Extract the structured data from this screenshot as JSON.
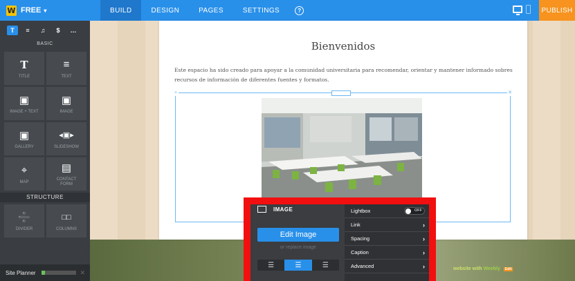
{
  "topbar": {
    "plan_label": "FREE",
    "tabs": [
      {
        "label": "BUILD"
      },
      {
        "label": "DESIGN"
      },
      {
        "label": "PAGES"
      },
      {
        "label": "SETTINGS"
      }
    ],
    "active_tab": "BUILD",
    "publish_label": "PUBLISH"
  },
  "sidebar": {
    "tools": [
      "T",
      "≡",
      "♫",
      "$",
      "…"
    ],
    "basic_label": "BASIC",
    "basic_items": [
      {
        "label": "TITLE",
        "icon": "T"
      },
      {
        "label": "TEXT",
        "icon": "≡"
      },
      {
        "label": "IMAGE + TEXT",
        "icon": "▣"
      },
      {
        "label": "IMAGE",
        "icon": "▣"
      },
      {
        "label": "GALLERY",
        "icon": "▣"
      },
      {
        "label": "SLIDESHOW",
        "icon": "◂▣▸"
      },
      {
        "label": "MAP",
        "icon": "⌖"
      },
      {
        "label": "CONTACT FORM",
        "icon": "▤"
      }
    ],
    "structure_label": "STRUCTURE",
    "structure_items": [
      {
        "label": "DIVIDER",
        "icon": "➗"
      },
      {
        "label": "COLUMNS",
        "icon": "□□"
      }
    ],
    "site_planner_label": "Site Planner",
    "site_planner_progress": 0.1
  },
  "page": {
    "title": "Bienvenidos",
    "body": "Este espacio ha sido creado para apoyar a la comunidad universitaria para recomendar, orientar y mantener informado sobres recursos de información de diferentes fuentes y formatos."
  },
  "image_panel": {
    "heading": "IMAGE",
    "edit_label": "Edit Image",
    "replace_label": "or replace image",
    "options": [
      {
        "label": "Lightbox",
        "type": "toggle",
        "value": "OFF"
      },
      {
        "label": "Link",
        "type": "arrow"
      },
      {
        "label": "Spacing",
        "type": "arrow"
      },
      {
        "label": "Caption",
        "type": "arrow"
      },
      {
        "label": "Advanced",
        "type": "arrow"
      }
    ]
  },
  "footer": {
    "text": "website with",
    "brand": "Weebly",
    "edit_tag": "Edit"
  },
  "colors": {
    "accent": "#2990ea",
    "publish": "#f7931e",
    "highlight": "#f20f0f"
  }
}
